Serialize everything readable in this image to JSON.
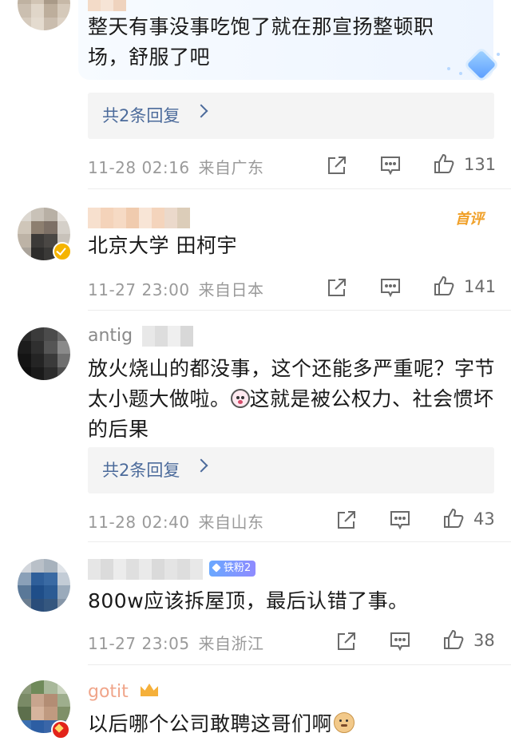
{
  "comments": [
    {
      "content": "整天有事没事吃饱了就在那宣扬整顿职场，舒服了吧",
      "reply_label": "共2条回复",
      "time": "11-28 02:16",
      "location": "来自广东",
      "likes": "131"
    },
    {
      "badge": "首评",
      "content": "北京大学 田柯宇",
      "time": "11-27 23:00",
      "location": "来自日本",
      "likes": "141"
    },
    {
      "name_fragment": "antig",
      "content_a": "放火烧山的都没事，这个还能多严重呢？字节太小题大做啦。",
      "content_b": "这就是被公权力、社会惯坏的后果",
      "emoji": "shocked-face-emoji",
      "reply_label": "共2条回复",
      "time": "11-28 02:40",
      "location": "来自山东",
      "likes": "43"
    },
    {
      "fan_badge": "铁粉2",
      "content": "800w应该拆屋顶，最后认错了事。",
      "time": "11-27 23:05",
      "location": "来自浙江",
      "likes": "38"
    },
    {
      "name_fragment": "gotit",
      "content": "以后哪个公司敢聘这哥们啊",
      "emoji": "doge-emoji"
    }
  ],
  "colors": {
    "link": "#4c6b9b",
    "meta": "#9a9a9a",
    "hot_badge": "#f0a028",
    "verify_gold": "#f5b400",
    "verify_red": "#e2231a"
  },
  "icons": [
    "share-icon",
    "comment-icon",
    "like-icon",
    "diamond-icon"
  ]
}
